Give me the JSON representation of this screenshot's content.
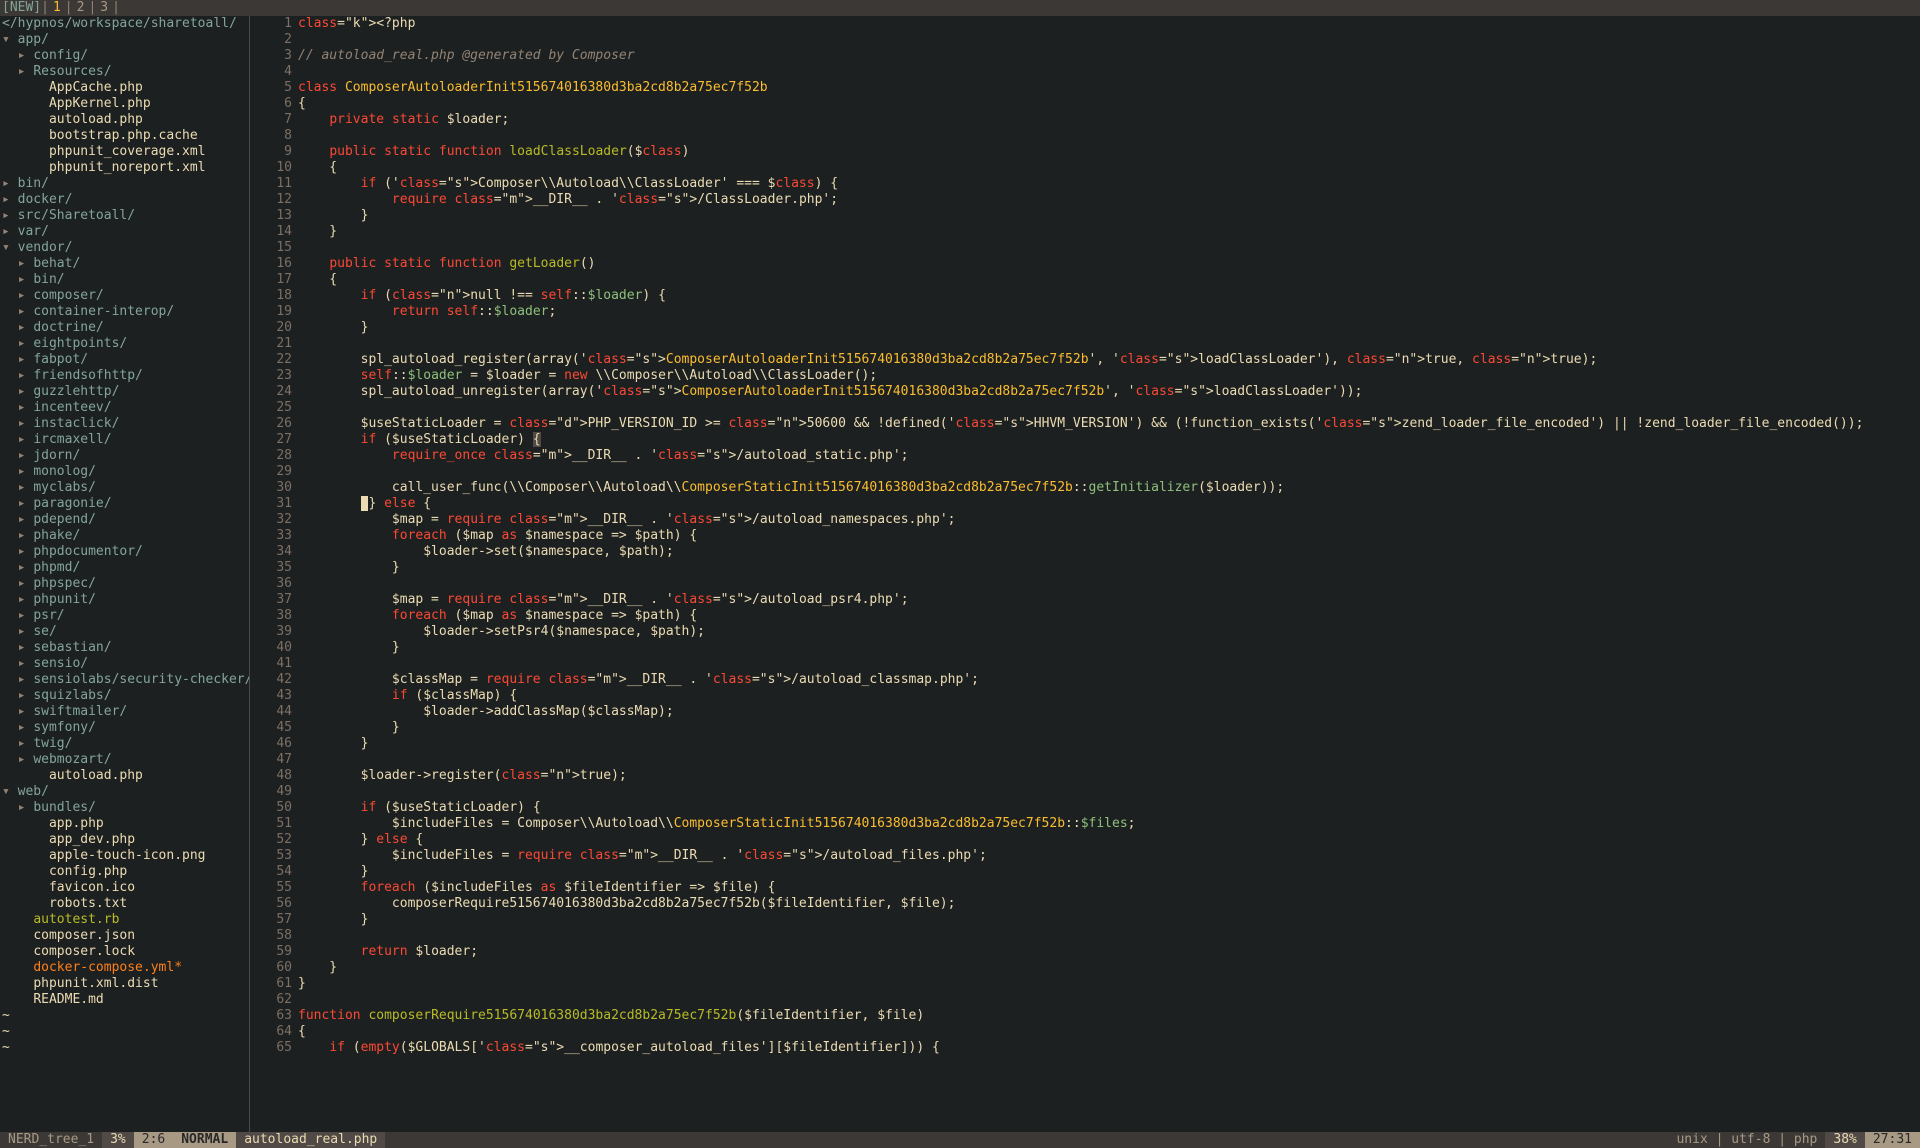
{
  "tabline": {
    "new": "[NEW]",
    "tabs": [
      "1",
      "2",
      "3"
    ]
  },
  "sidebar": {
    "path": "</hypnos/workspace/sharetoall/",
    "tree": [
      {
        "indent": 0,
        "t": "dir",
        "marker": "▾",
        "label": "app/"
      },
      {
        "indent": 1,
        "t": "dir",
        "marker": "▸",
        "label": "config/"
      },
      {
        "indent": 1,
        "t": "dir",
        "marker": "▸",
        "label": "Resources/"
      },
      {
        "indent": 2,
        "t": "file",
        "marker": " ",
        "label": "AppCache.php"
      },
      {
        "indent": 2,
        "t": "file",
        "marker": " ",
        "label": "AppKernel.php"
      },
      {
        "indent": 2,
        "t": "file",
        "marker": " ",
        "label": "autoload.php"
      },
      {
        "indent": 2,
        "t": "file",
        "marker": " ",
        "label": "bootstrap.php.cache"
      },
      {
        "indent": 2,
        "t": "file",
        "marker": " ",
        "label": "phpunit_coverage.xml"
      },
      {
        "indent": 2,
        "t": "file",
        "marker": " ",
        "label": "phpunit_noreport.xml"
      },
      {
        "indent": 0,
        "t": "dir",
        "marker": "▸",
        "label": "bin/"
      },
      {
        "indent": 0,
        "t": "dir",
        "marker": "▸",
        "label": "docker/"
      },
      {
        "indent": 0,
        "t": "dir",
        "marker": "▸",
        "label": "src/Sharetoall/"
      },
      {
        "indent": 0,
        "t": "dir",
        "marker": "▸",
        "label": "var/"
      },
      {
        "indent": 0,
        "t": "dir",
        "marker": "▾",
        "label": "vendor/"
      },
      {
        "indent": 1,
        "t": "dir",
        "marker": "▸",
        "label": "behat/"
      },
      {
        "indent": 1,
        "t": "dir",
        "marker": "▸",
        "label": "bin/"
      },
      {
        "indent": 1,
        "t": "dir",
        "marker": "▸",
        "label": "composer/"
      },
      {
        "indent": 1,
        "t": "dir",
        "marker": "▸",
        "label": "container-interop/"
      },
      {
        "indent": 1,
        "t": "dir",
        "marker": "▸",
        "label": "doctrine/"
      },
      {
        "indent": 1,
        "t": "dir",
        "marker": "▸",
        "label": "eightpoints/"
      },
      {
        "indent": 1,
        "t": "dir",
        "marker": "▸",
        "label": "fabpot/"
      },
      {
        "indent": 1,
        "t": "dir",
        "marker": "▸",
        "label": "friendsofhttp/"
      },
      {
        "indent": 1,
        "t": "dir",
        "marker": "▸",
        "label": "guzzlehttp/"
      },
      {
        "indent": 1,
        "t": "dir",
        "marker": "▸",
        "label": "incenteev/"
      },
      {
        "indent": 1,
        "t": "dir",
        "marker": "▸",
        "label": "instaclick/"
      },
      {
        "indent": 1,
        "t": "dir",
        "marker": "▸",
        "label": "ircmaxell/"
      },
      {
        "indent": 1,
        "t": "dir",
        "marker": "▸",
        "label": "jdorn/"
      },
      {
        "indent": 1,
        "t": "dir",
        "marker": "▸",
        "label": "monolog/"
      },
      {
        "indent": 1,
        "t": "dir",
        "marker": "▸",
        "label": "myclabs/"
      },
      {
        "indent": 1,
        "t": "dir",
        "marker": "▸",
        "label": "paragonie/"
      },
      {
        "indent": 1,
        "t": "dir",
        "marker": "▸",
        "label": "pdepend/"
      },
      {
        "indent": 1,
        "t": "dir",
        "marker": "▸",
        "label": "phake/"
      },
      {
        "indent": 1,
        "t": "dir",
        "marker": "▸",
        "label": "phpdocumentor/"
      },
      {
        "indent": 1,
        "t": "dir",
        "marker": "▸",
        "label": "phpmd/"
      },
      {
        "indent": 1,
        "t": "dir",
        "marker": "▸",
        "label": "phpspec/"
      },
      {
        "indent": 1,
        "t": "dir",
        "marker": "▸",
        "label": "phpunit/"
      },
      {
        "indent": 1,
        "t": "dir",
        "marker": "▸",
        "label": "psr/"
      },
      {
        "indent": 1,
        "t": "dir",
        "marker": "▸",
        "label": "se/"
      },
      {
        "indent": 1,
        "t": "dir",
        "marker": "▸",
        "label": "sebastian/"
      },
      {
        "indent": 1,
        "t": "dir",
        "marker": "▸",
        "label": "sensio/"
      },
      {
        "indent": 1,
        "t": "dir",
        "marker": "▸",
        "label": "sensiolabs/security-checker/"
      },
      {
        "indent": 1,
        "t": "dir",
        "marker": "▸",
        "label": "squizlabs/"
      },
      {
        "indent": 1,
        "t": "dir",
        "marker": "▸",
        "label": "swiftmailer/"
      },
      {
        "indent": 1,
        "t": "dir",
        "marker": "▸",
        "label": "symfony/"
      },
      {
        "indent": 1,
        "t": "dir",
        "marker": "▸",
        "label": "twig/"
      },
      {
        "indent": 1,
        "t": "dir",
        "marker": "▸",
        "label": "webmozart/"
      },
      {
        "indent": 2,
        "t": "file",
        "marker": " ",
        "label": "autoload.php"
      },
      {
        "indent": 0,
        "t": "dir",
        "marker": "▾",
        "label": "web/"
      },
      {
        "indent": 1,
        "t": "dir",
        "marker": "▸",
        "label": "bundles/"
      },
      {
        "indent": 2,
        "t": "file",
        "marker": " ",
        "label": "app.php"
      },
      {
        "indent": 2,
        "t": "file",
        "marker": " ",
        "label": "app_dev.php"
      },
      {
        "indent": 2,
        "t": "file",
        "marker": " ",
        "label": "apple-touch-icon.png"
      },
      {
        "indent": 2,
        "t": "file",
        "marker": " ",
        "label": "config.php"
      },
      {
        "indent": 2,
        "t": "file",
        "marker": " ",
        "label": "favicon.ico"
      },
      {
        "indent": 2,
        "t": "file",
        "marker": " ",
        "label": "robots.txt"
      },
      {
        "indent": 1,
        "t": "exec",
        "marker": " ",
        "label": "autotest.rb"
      },
      {
        "indent": 1,
        "t": "file",
        "marker": " ",
        "label": "composer.json"
      },
      {
        "indent": 1,
        "t": "file",
        "marker": " ",
        "label": "composer.lock"
      },
      {
        "indent": 1,
        "t": "modified",
        "marker": " ",
        "label": "docker-compose.yml*"
      },
      {
        "indent": 1,
        "t": "file",
        "marker": " ",
        "label": "phpunit.xml.dist"
      },
      {
        "indent": 1,
        "t": "file",
        "marker": " ",
        "label": "README.md"
      }
    ]
  },
  "code": {
    "lines": [
      "<?php",
      "",
      "// autoload_real.php @generated by Composer",
      "",
      "class ComposerAutoloaderInit515674016380d3ba2cd8b2a75ec7f52b",
      "{",
      "    private static $loader;",
      "",
      "    public static function loadClassLoader($class)",
      "    {",
      "        if ('Composer\\\\Autoload\\\\ClassLoader' === $class) {",
      "            require __DIR__ . '/ClassLoader.php';",
      "        }",
      "    }",
      "",
      "    public static function getLoader()",
      "    {",
      "        if (null !== self::$loader) {",
      "            return self::$loader;",
      "        }",
      "",
      "        spl_autoload_register(array('ComposerAutoloaderInit515674016380d3ba2cd8b2a75ec7f52b', 'loadClassLoader'), true, true);",
      "        self::$loader = $loader = new \\\\Composer\\\\Autoload\\\\ClassLoader();",
      "        spl_autoload_unregister(array('ComposerAutoloaderInit515674016380d3ba2cd8b2a75ec7f52b', 'loadClassLoader'));",
      "",
      "        $useStaticLoader = PHP_VERSION_ID >= 50600 && !defined('HHVM_VERSION') && (!function_exists('zend_loader_file_encoded') || !zend_loader_file_encoded());",
      "        if ($useStaticLoader) {",
      "            require_once __DIR__ . '/autoload_static.php';",
      "",
      "            call_user_func(\\\\Composer\\\\Autoload\\\\ComposerStaticInit515674016380d3ba2cd8b2a75ec7f52b::getInitializer($loader));",
      "        } else {",
      "            $map = require __DIR__ . '/autoload_namespaces.php';",
      "            foreach ($map as $namespace => $path) {",
      "                $loader->set($namespace, $path);",
      "            }",
      "",
      "            $map = require __DIR__ . '/autoload_psr4.php';",
      "            foreach ($map as $namespace => $path) {",
      "                $loader->setPsr4($namespace, $path);",
      "            }",
      "",
      "            $classMap = require __DIR__ . '/autoload_classmap.php';",
      "            if ($classMap) {",
      "                $loader->addClassMap($classMap);",
      "            }",
      "        }",
      "",
      "        $loader->register(true);",
      "",
      "        if ($useStaticLoader) {",
      "            $includeFiles = Composer\\\\Autoload\\\\ComposerStaticInit515674016380d3ba2cd8b2a75ec7f52b::$files;",
      "        } else {",
      "            $includeFiles = require __DIR__ . '/autoload_files.php';",
      "        }",
      "        foreach ($includeFiles as $fileIdentifier => $file) {",
      "            composerRequire515674016380d3ba2cd8b2a75ec7f52b($fileIdentifier, $file);",
      "        }",
      "",
      "        return $loader;",
      "    }",
      "}",
      "",
      "function composerRequire515674016380d3ba2cd8b2a75ec7f52b($fileIdentifier, $file)",
      "{",
      "    if (empty($GLOBALS['__composer_autoload_files'][$fileIdentifier])) {"
    ]
  },
  "status_left": {
    "name": "NERD_tree_1",
    "pct": "3%",
    "pos": "2:6"
  },
  "status_right": {
    "mode": "NORMAL",
    "file": "autoload_real.php",
    "enc": "unix | utf-8 | php",
    "pct": "38%",
    "pos": "27:31"
  }
}
